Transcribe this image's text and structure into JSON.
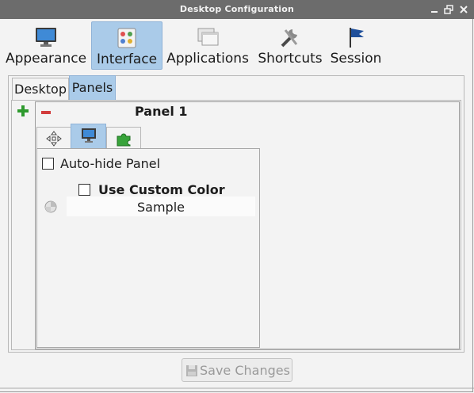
{
  "window": {
    "title": "Desktop Configuration"
  },
  "toolbar": {
    "items": [
      {
        "label": "Appearance",
        "icon": "monitor-icon"
      },
      {
        "label": "Interface",
        "icon": "interface-icon",
        "active": true
      },
      {
        "label": "Applications",
        "icon": "windows-icon"
      },
      {
        "label": "Shortcuts",
        "icon": "tools-icon"
      },
      {
        "label": "Session",
        "icon": "flag-icon"
      }
    ]
  },
  "tabs": {
    "desktop": "Desktop",
    "panels": "Panels",
    "selected": "Panels"
  },
  "panel": {
    "name": "Panel 1",
    "sub_tabs": [
      "position-icon",
      "monitor-icon",
      "plugin-icon"
    ],
    "auto_hide_label": "Auto-hide Panel",
    "auto_hide_checked": false,
    "custom_color_label": "Use Custom Color",
    "custom_color_checked": false,
    "sample_label": "Sample"
  },
  "footer": {
    "save_label": "Save Changes"
  },
  "colors": {
    "titlebar": "#6c6c6c",
    "selected": "#aacbe9",
    "add": "#2e9a2e",
    "remove": "#d23c3c"
  }
}
